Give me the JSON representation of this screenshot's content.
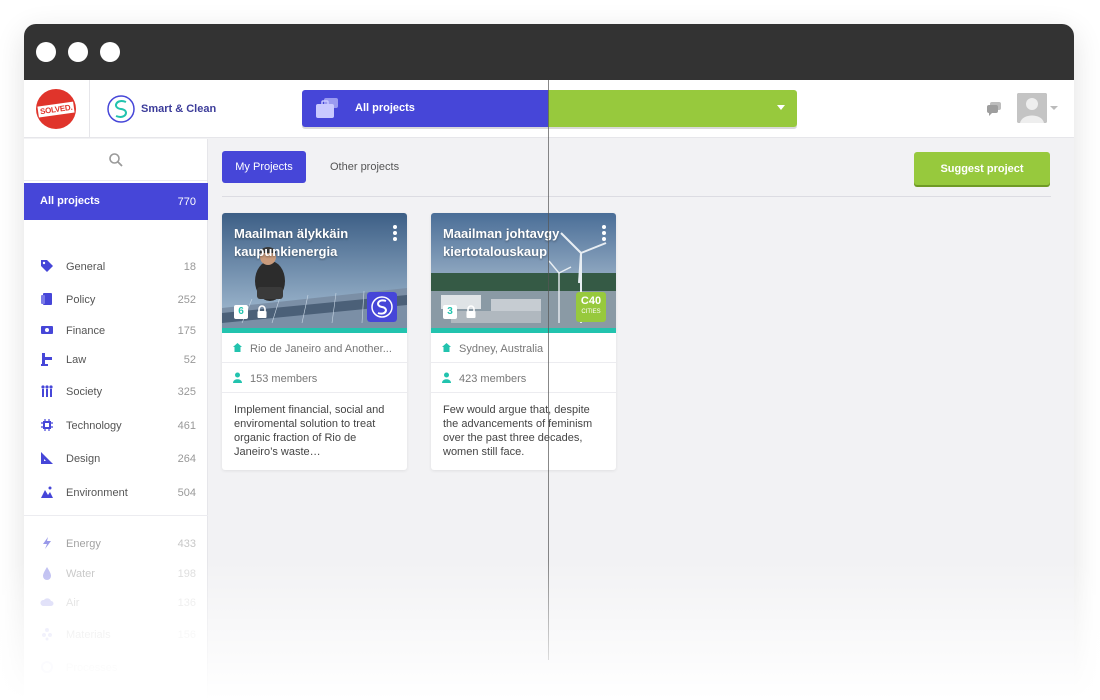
{
  "window": {
    "dots": [
      "window-dot",
      "window-dot",
      "window-dot"
    ]
  },
  "header": {
    "brand_badge": "SOLVED.",
    "partner_name": "Smart & Clean",
    "project_selector": {
      "label": "All projects",
      "icon": "briefcase-icon",
      "left_color": "#4646d8",
      "right_color": "#97c93d"
    },
    "chat_icon": "chat-icon",
    "avatar_icon": "user-avatar"
  },
  "sidebar": {
    "search_icon": "search-icon",
    "active": {
      "label": "All projects",
      "count": "770"
    },
    "items": [
      {
        "label": "General",
        "count": "18",
        "icon": "tag-icon"
      },
      {
        "label": "Policy",
        "count": "252",
        "icon": "document-icon"
      },
      {
        "label": "Finance",
        "count": "175",
        "icon": "money-icon"
      },
      {
        "label": "Law",
        "count": "52",
        "icon": "gavel-icon"
      },
      {
        "label": "Society",
        "count": "325",
        "icon": "people-icon"
      },
      {
        "label": "Technology",
        "count": "461",
        "icon": "chip-icon"
      },
      {
        "label": "Design",
        "count": "264",
        "icon": "ruler-icon"
      },
      {
        "label": "Environment",
        "count": "504",
        "icon": "landscape-icon"
      }
    ],
    "items_secondary": [
      {
        "label": "Energy",
        "count": "433",
        "icon": "lightning-icon"
      },
      {
        "label": "Water",
        "count": "198",
        "icon": "drop-icon"
      },
      {
        "label": "Air",
        "count": "136",
        "icon": "cloud-icon"
      },
      {
        "label": "Materials",
        "count": "156",
        "icon": "materials-icon"
      },
      {
        "label": "Processes",
        "count": "",
        "icon": "process-icon"
      }
    ]
  },
  "main": {
    "tabs": [
      {
        "label": "My Projects",
        "active": true
      },
      {
        "label": "Other projects",
        "active": false
      }
    ],
    "suggest_button": "Suggest project",
    "cards": [
      {
        "title": "Maailman älykkäin kaupunkienergia",
        "number": "6",
        "location": "Rio de Janeiro and Another...",
        "members": "153 members",
        "description": "Implement financial, social and enviromental solution to treat organic fraction of Rio de Janeiro’s waste…",
        "org_logo": "smart-clean-logo"
      },
      {
        "title": "Maailman johtavgy kiertotalouskaup",
        "number": "3",
        "location": "Sydney, Australia",
        "members": "423 members",
        "description": "Few would argue that, despite the advancements of feminism over the past three decades, women still face.",
        "org_logo": "c40-cities-logo",
        "org_logo_text": "C40",
        "org_logo_sub": "CITIES"
      }
    ]
  },
  "colors": {
    "primary": "#4646d8",
    "accent": "#97c93d",
    "teal": "#22c3ae",
    "brand_red": "#e0342b"
  }
}
